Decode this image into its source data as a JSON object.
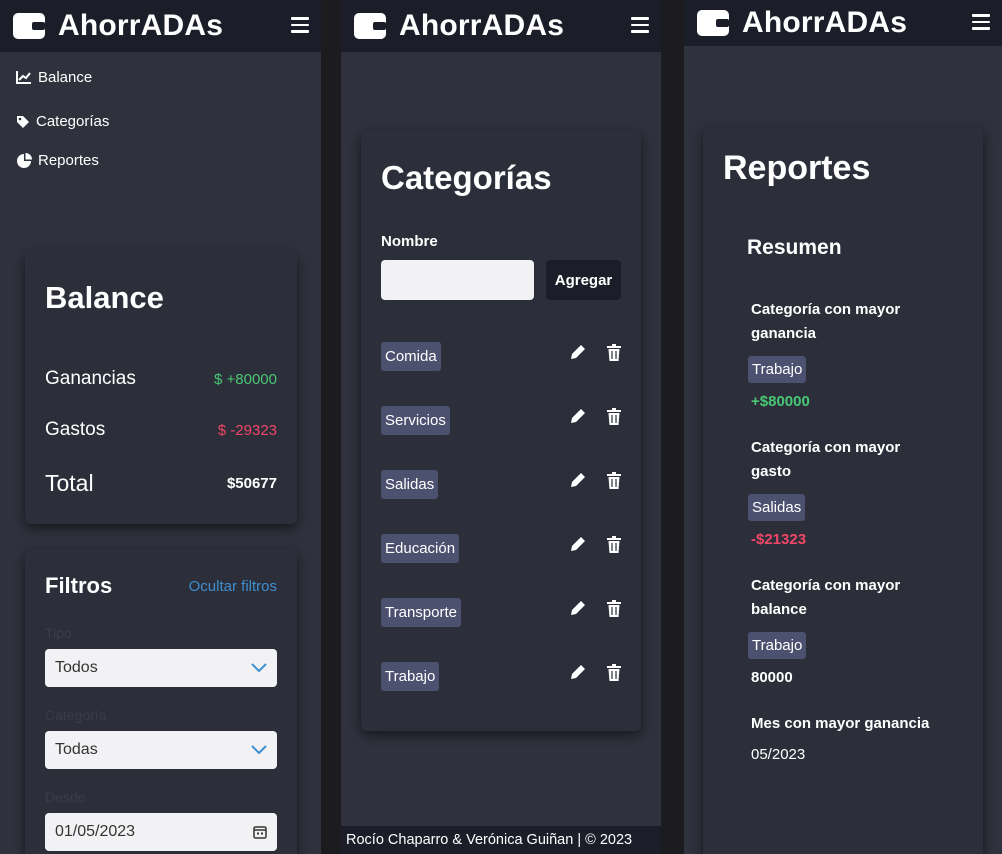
{
  "app": {
    "name": "AhorrADAs"
  },
  "nav": {
    "items": [
      {
        "label": "Balance"
      },
      {
        "label": "Categorías"
      },
      {
        "label": "Reportes"
      }
    ]
  },
  "balance": {
    "title": "Balance",
    "rows": [
      {
        "label": "Ganancias",
        "value": "$ +80000"
      },
      {
        "label": "Gastos",
        "value": "$ -29323"
      },
      {
        "label": "Total",
        "value": "$50677"
      }
    ]
  },
  "filters": {
    "title": "Filtros",
    "toggle_label": "Ocultar filtros",
    "type_label": "Tipo",
    "type_value": "Todos",
    "category_label": "Categoría",
    "category_value": "Todas",
    "date_label": "Desde",
    "date_value": "01/05/2023"
  },
  "categories": {
    "title": "Categorías",
    "name_label": "Nombre",
    "add_button": "Agregar",
    "items": [
      "Comida",
      "Servicios",
      "Salidas",
      "Educación",
      "Transporte",
      "Trabajo"
    ]
  },
  "footer": {
    "text": "Rocío Chaparro & Verónica Guiñan | © 2023"
  },
  "reports": {
    "title": "Reportes",
    "subtitle": "Resumen",
    "blocks": [
      {
        "heading": "Categoría con mayor ganancia",
        "tag": "Trabajo",
        "value": "+$80000"
      },
      {
        "heading": "Categoría con mayor gasto",
        "tag": "Salidas",
        "value": "-$21323"
      },
      {
        "heading": "Categoría con mayor balance",
        "tag": "Trabajo",
        "value": "80000"
      },
      {
        "heading": "Mes con mayor ganancia",
        "value": "05/2023"
      }
    ]
  },
  "colors": {
    "navbar": "#1b1e29",
    "background": "#2f323d",
    "positive": "#48c774",
    "negative": "#f14668",
    "link": "#3e8ed0",
    "tag": "#4d5170"
  },
  "icons": [
    "wallet-icon",
    "hamburger-icon",
    "chart-line-icon",
    "tag-icon",
    "pie-chart-icon",
    "pencil-icon",
    "trash-icon",
    "chevron-down-icon",
    "calendar-icon"
  ]
}
